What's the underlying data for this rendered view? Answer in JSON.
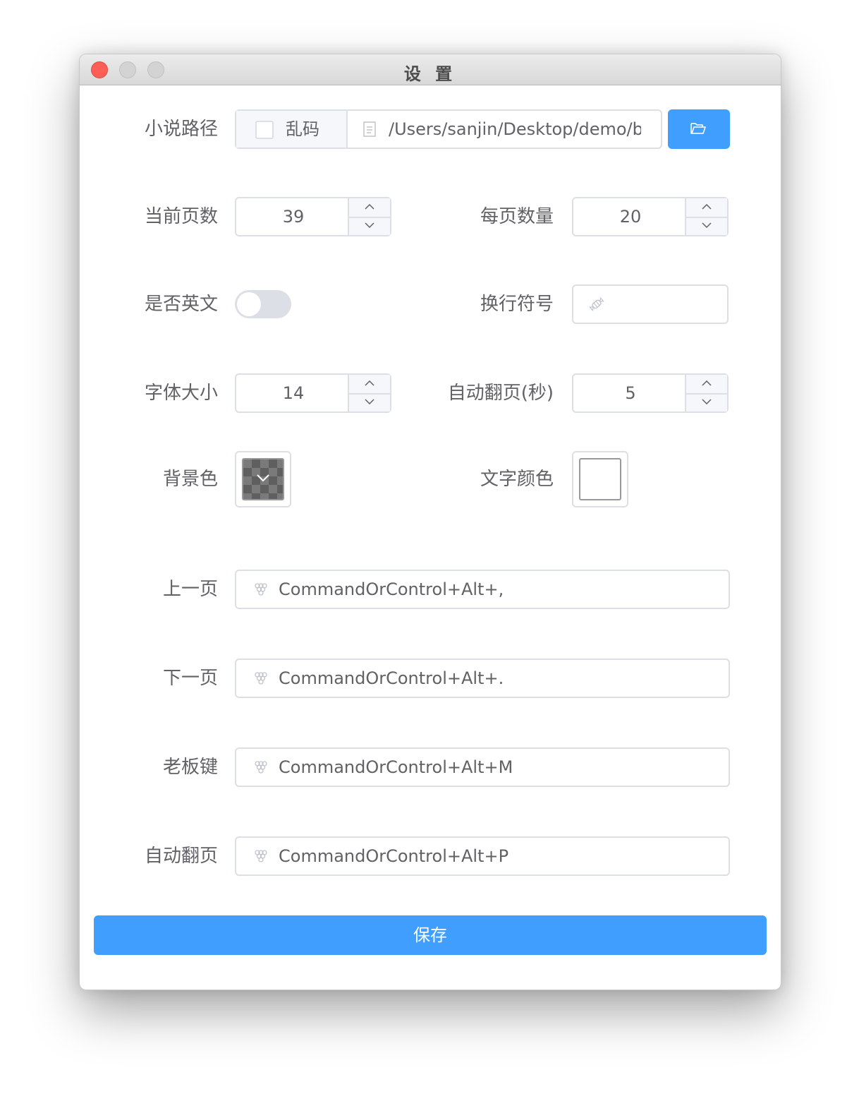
{
  "window": {
    "title": "设 置",
    "controls": [
      "close",
      "minimize",
      "maximize"
    ]
  },
  "path_row": {
    "label": "小说路径",
    "checkbox_label": "乱码",
    "checkbox_checked": false,
    "path_value": "/Users/sanjin/Desktop/demo/bo",
    "path_icon": "document-icon",
    "browse_icon": "folder-open-icon"
  },
  "current_page": {
    "label": "当前页数",
    "value": "39"
  },
  "page_size": {
    "label": "每页数量",
    "value": "20"
  },
  "is_english": {
    "label": "是否英文",
    "enabled": false
  },
  "line_break": {
    "label": "换行符号",
    "value": "",
    "icon": "candy-icon"
  },
  "font_size": {
    "label": "字体大小",
    "value": "14"
  },
  "auto_page_seconds": {
    "label": "自动翻页(秒)",
    "value": "5"
  },
  "background_color": {
    "label": "背景色",
    "value": "transparent"
  },
  "text_color": {
    "label": "文字颜色",
    "value": "#ffffff"
  },
  "shortcuts": [
    {
      "label": "上一页",
      "value": "CommandOrControl+Alt+,",
      "icon": "grape-icon"
    },
    {
      "label": "下一页",
      "value": "CommandOrControl+Alt+.",
      "icon": "grape-icon"
    },
    {
      "label": "老板键",
      "value": "CommandOrControl+Alt+M",
      "icon": "grape-icon"
    },
    {
      "label": "自动翻页",
      "value": "CommandOrControl+Alt+P",
      "icon": "grape-icon"
    }
  ],
  "save_button": {
    "label": "保存"
  },
  "colors": {
    "primary": "#409eff",
    "border": "#dcdfe6",
    "text": "#606266",
    "close": "#fd5f57"
  }
}
